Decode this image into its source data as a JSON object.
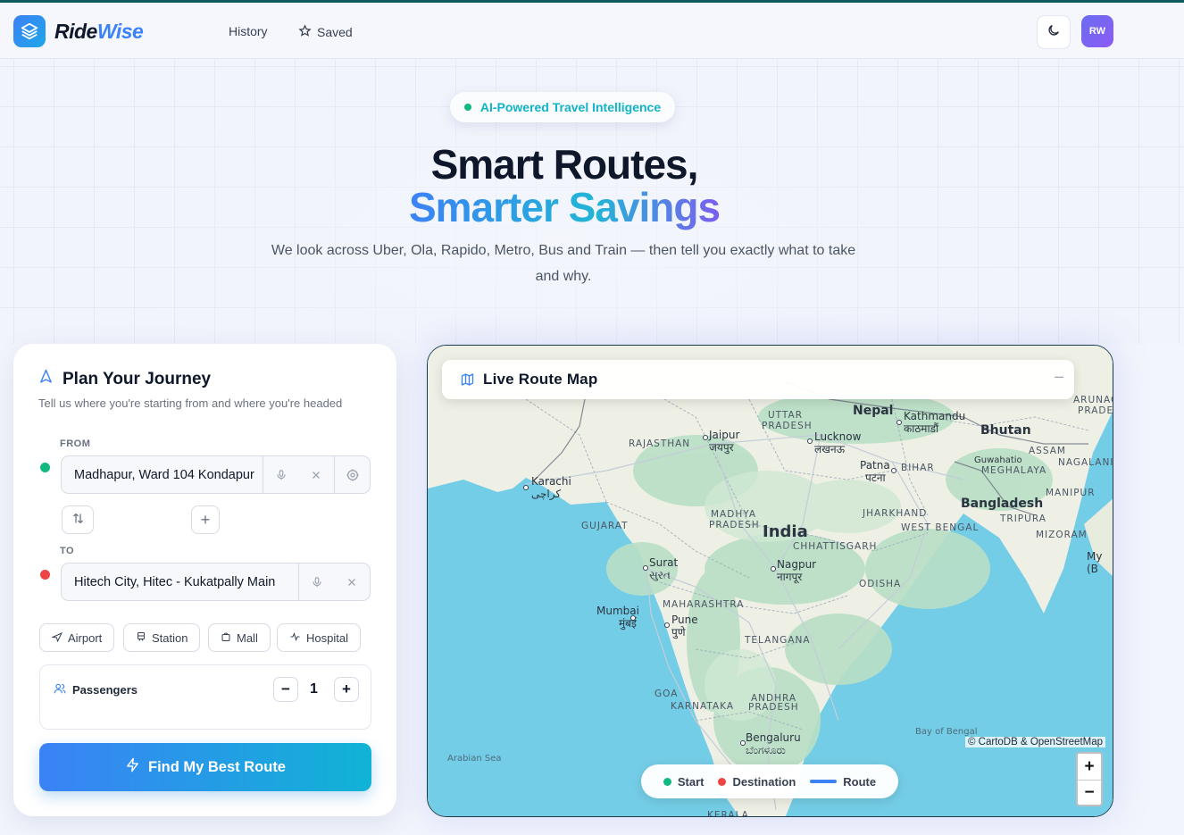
{
  "header": {
    "brand_part1": "Ride",
    "brand_part2": "Wise",
    "nav": [
      {
        "label": "History"
      },
      {
        "label": "Saved"
      }
    ],
    "avatar_initials": "RW"
  },
  "hero": {
    "badge": "AI-Powered Travel Intelligence",
    "title_line1": "Smart Routes,",
    "title_line2": "Smarter Savings",
    "subtitle": "We look across Uber, Ola, Rapido, Metro, Bus and Train — then tell you exactly what to take and why."
  },
  "journey": {
    "title": "Plan Your Journey",
    "subtitle": "Tell us where you're starting from and where you're headed",
    "from_label": "FROM",
    "from_value": "Madhapur, Ward 104 Kondapur",
    "to_label": "TO",
    "to_value": "Hitech City, Hitec - Kukatpally Main",
    "quick_chips": [
      "Airport",
      "Station",
      "Mall",
      "Hospital"
    ],
    "passengers_label": "Passengers",
    "passengers_value": "1",
    "find_button": "Find My Best Route"
  },
  "map": {
    "title": "Live Route Map",
    "labels": {
      "nepal": "Nepal",
      "kathmandu": "Kathmandu",
      "kathmandu_local": "काठमाडौं",
      "bhutan": "Bhutan",
      "uttar_pradesh_1": "UTTAR",
      "uttar_pradesh_2": "PRADESH",
      "lucknow": "Lucknow",
      "lucknow_local": "लखनऊ",
      "jaipur": "Jaipur",
      "jaipur_local": "जयपुर",
      "rajasthan": "RAJASTHAN",
      "patna": "Patna",
      "patna_local": "पटना",
      "bihar": "BIHAR",
      "assam": "ASSAM",
      "guwahati": "Guwahatio",
      "meghalaya": "MEGHALAYA",
      "nagaland": "NAGALANI",
      "arunachal_1": "ARUNACH",
      "arunachal_2": "PRADES",
      "karachi": "Karachi",
      "karachi_local": "كراچی",
      "bangladesh": "Bangladesh",
      "manipur": "MANIPUR",
      "tripura": "TRIPURA",
      "mizoram": "MIZORAM",
      "jharkhand": "JHARKHAND",
      "west_bengal": "WEST BENGAL",
      "gujarat": "GUJARAT",
      "madhya_1": "MADHYA",
      "madhya_2": "PRADESH",
      "india": "India",
      "chhattisgarh": "CHHATTISGARH",
      "surat": "Surat",
      "surat_local": "સુરત",
      "nagpur": "Nagpur",
      "nagpur_local": "नागपूर",
      "odisha": "ODISHA",
      "my_1": "My",
      "my_2": "(B",
      "mumbai": "Mumbai",
      "mumbai_local": "मुंबई",
      "maharashtra": "MAHARASHTRA",
      "pune": "Pune",
      "pune_local": "पुणे",
      "telangana": "TELANGANA",
      "goa": "GOA",
      "andhra_1": "ANDHRA",
      "andhra_2": "PRADESH",
      "karnataka": "KARNATAKA",
      "bay_of_bengal": "Bay of Bengal",
      "bengaluru": "Bengaluru",
      "bengaluru_local": "ಬೆಂಗಳೂರು",
      "arabian_sea": "Arabian Sea",
      "kerala": "KERALA"
    },
    "attribution": "© CartoDB & OpenStreetMap",
    "zoom_in": "+",
    "zoom_out": "−",
    "legend": {
      "start": "Start",
      "destination": "Destination",
      "route": "Route"
    }
  },
  "colors": {
    "accent_blue": "#3b82f6",
    "accent_cyan": "#10b3c7",
    "start_green": "#10b981",
    "destination_red": "#ef4444",
    "water": "#74cde6",
    "land": "#eef0e6"
  }
}
